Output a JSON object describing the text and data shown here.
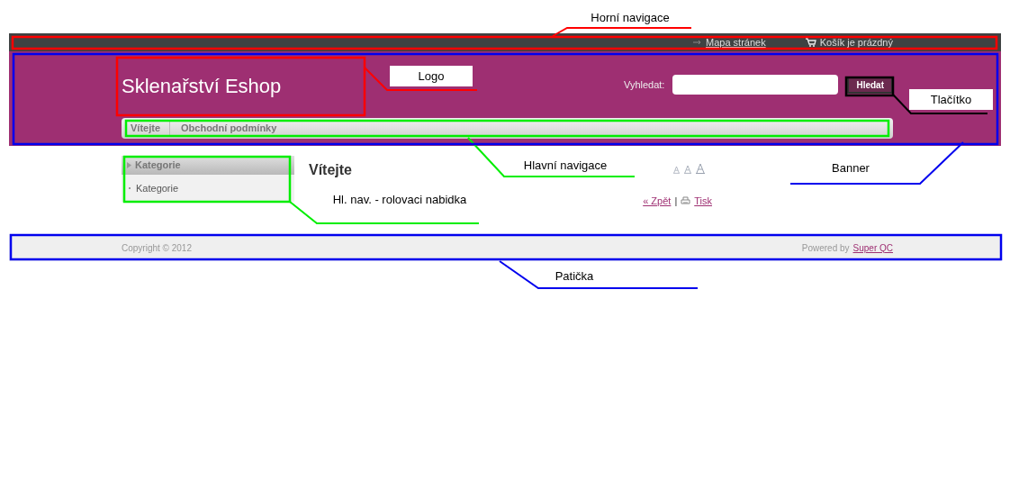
{
  "top_nav": {
    "sitemap_link": "Mapa stránek",
    "cart_status": "Košík je prázdný"
  },
  "header": {
    "logo": "Sklenařství Eshop",
    "search": {
      "label": "Vyhledat:",
      "button": "Hledat"
    }
  },
  "main_nav": [
    "Vítejte",
    "Obchodní podmínky"
  ],
  "sidebar": {
    "title": "Kategorie",
    "items": [
      "Kategorie"
    ]
  },
  "content": {
    "title": "Vítejte",
    "back_link": "« Zpět",
    "separator": "|",
    "print_link": "Tisk"
  },
  "footer": {
    "copyright": "Copyright © 2012",
    "powered_by": "Powered by",
    "powered_link": "Super QC"
  },
  "annotations": [
    {
      "label": "Horní navigace",
      "color": "#ff0000"
    },
    {
      "label": "Logo",
      "color": "#ff0000"
    },
    {
      "label": "Tlačítko",
      "color": "#000000"
    },
    {
      "label": "Hlavní navigace",
      "color": "#00ee00"
    },
    {
      "label": "Banner",
      "color": "#0000ee"
    },
    {
      "label": "Hl. nav. - rolovaci nabidka",
      "color": "#00ee00"
    },
    {
      "label": "Patička",
      "color": "#0000ee"
    }
  ]
}
